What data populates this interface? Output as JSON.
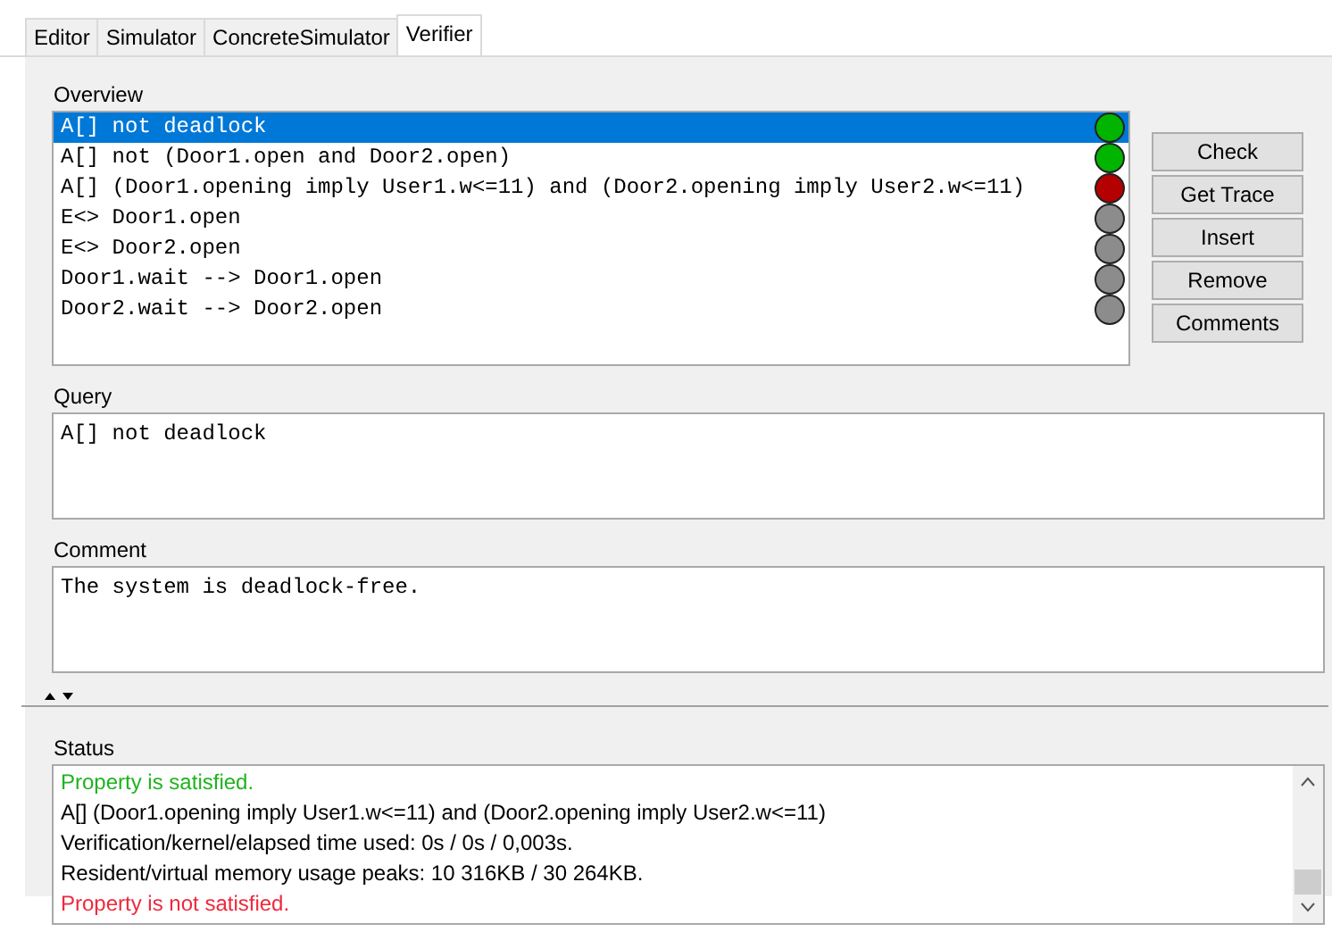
{
  "tabs": [
    {
      "label": "Editor",
      "selected": false
    },
    {
      "label": "Simulator",
      "selected": false
    },
    {
      "label": "ConcreteSimulator",
      "selected": false
    },
    {
      "label": "Verifier",
      "selected": true
    }
  ],
  "overview": {
    "label": "Overview",
    "items": [
      {
        "text": "A[] not deadlock",
        "selected": true,
        "color": "#00b400"
      },
      {
        "text": "A[] not (Door1.open and Door2.open)",
        "selected": false,
        "color": "#00b400"
      },
      {
        "text": "A[] (Door1.opening imply User1.w<=11) and (Door2.opening imply User2.w<=11)",
        "selected": false,
        "color": "#b40000"
      },
      {
        "text": "E<> Door1.open",
        "selected": false,
        "color": "#8c8c8c"
      },
      {
        "text": "E<> Door2.open",
        "selected": false,
        "color": "#8c8c8c"
      },
      {
        "text": "Door1.wait --> Door1.open",
        "selected": false,
        "color": "#8c8c8c"
      },
      {
        "text": "Door2.wait --> Door2.open",
        "selected": false,
        "color": "#8c8c8c"
      }
    ]
  },
  "buttons": [
    "Check",
    "Get Trace",
    "Insert",
    "Remove",
    "Comments"
  ],
  "query": {
    "label": "Query",
    "value": "A[] not deadlock"
  },
  "comment": {
    "label": "Comment",
    "value": "The system is deadlock-free."
  },
  "status": {
    "label": "Status",
    "lines": [
      {
        "text": "Property is satisfied.",
        "kind": "success"
      },
      {
        "text": "A[] (Door1.opening imply User1.w<=11) and (Door2.opening imply User2.w<=11)",
        "kind": "normal"
      },
      {
        "text": "Verification/kernel/elapsed time used: 0s / 0s / 0,003s.",
        "kind": "normal"
      },
      {
        "text": "Resident/virtual memory usage peaks: 10 316KB / 30 264KB.",
        "kind": "normal"
      },
      {
        "text": "Property is not satisfied.",
        "kind": "failure"
      }
    ]
  }
}
